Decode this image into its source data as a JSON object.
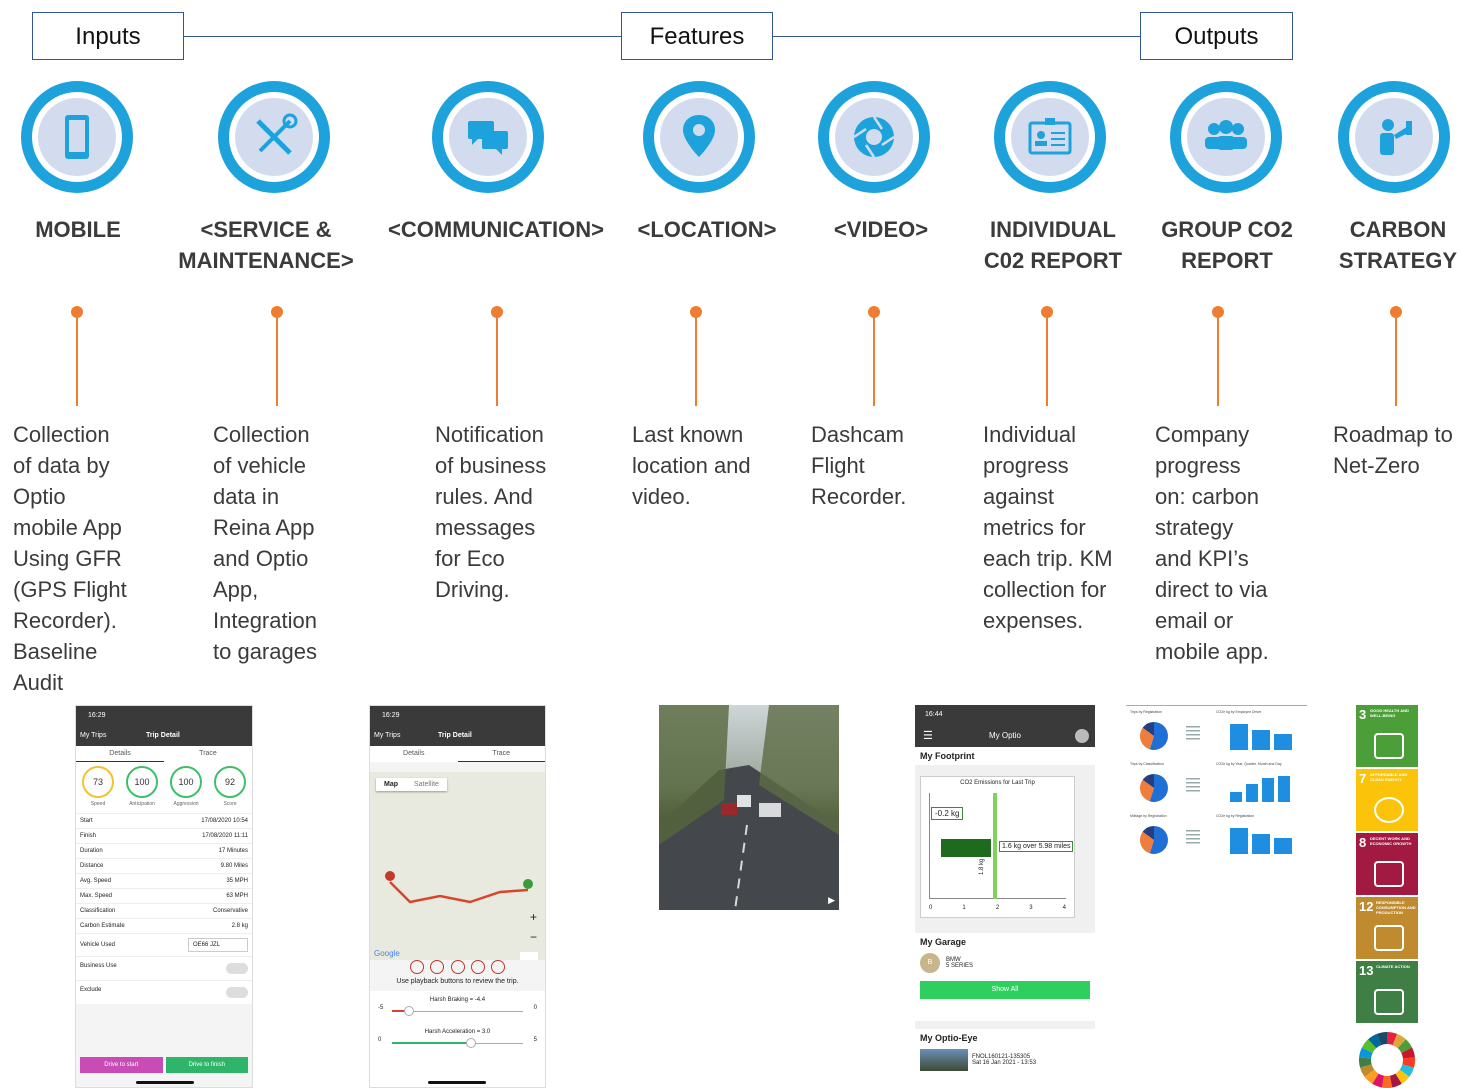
{
  "headers": {
    "inputs": "Inputs",
    "features": "Features",
    "outputs": "Outputs"
  },
  "columns": [
    {
      "icon": "mobile-phone-icon",
      "title": "MOBILE",
      "description": "Collection\nof data by\nOptio\nmobile App\nUsing GFR\n(GPS Flight\nRecorder).\nBaseline\nAudit"
    },
    {
      "icon": "tools-icon",
      "title": "<SERVICE &\nMAINTENANCE>",
      "description": "Collection\nof vehicle\ndata in\nReina App\nand Optio\nApp,\nIntegration\nto garages"
    },
    {
      "icon": "chat-bubbles-icon",
      "title": "<COMMUNICATION>",
      "description": "Notification\nof business\nrules. And\nmessages\nfor Eco\nDriving."
    },
    {
      "icon": "location-pin-icon",
      "title": "<LOCATION>",
      "description": "Last known\nlocation and\nvideo."
    },
    {
      "icon": "camera-shutter-icon",
      "title": "<VIDEO>",
      "description": "Dashcam\nFlight\nRecorder."
    },
    {
      "icon": "id-badge-icon",
      "title": "INDIVIDUAL\nC02  REPORT",
      "description": "Individual\nprogress\nagainst\nmetrics for\neach trip. KM\ncollection for\nexpenses."
    },
    {
      "icon": "group-icon",
      "title": "GROUP CO2\nREPORT",
      "description": "Company\nprogress\non:  carbon\nstrategy\nand KPI’s\ndirect to via\nemail or\nmobile app."
    },
    {
      "icon": "presenter-icon",
      "title": "CARBON\nSTRATEGY",
      "description": "Roadmap to\nNet-Zero"
    }
  ],
  "phone1": {
    "time": "16:29",
    "back": "My Trips",
    "title": "Trip Detail",
    "tabs": [
      "Details",
      "Trace"
    ],
    "gauges": [
      {
        "value": "73",
        "label": "Speed",
        "color": "#f2c230"
      },
      {
        "value": "100",
        "label": "Anticipation",
        "color": "#3fbf6a"
      },
      {
        "value": "100",
        "label": "Aggression",
        "color": "#3fbf6a"
      },
      {
        "value": "92",
        "label": "Score",
        "color": "#3fbf6a"
      }
    ],
    "rows": [
      {
        "k": "Start",
        "v": "17/08/2020 10:54"
      },
      {
        "k": "Finish",
        "v": "17/08/2020 11:11"
      },
      {
        "k": "Duration",
        "v": "17 Minutes"
      },
      {
        "k": "Distance",
        "v": "9.80 Miles"
      },
      {
        "k": "Avg. Speed",
        "v": "35 MPH"
      },
      {
        "k": "Max. Speed",
        "v": "63 MPH"
      },
      {
        "k": "Classification",
        "v": "Conservative"
      },
      {
        "k": "Carbon Estimate",
        "v": "2.8 kg"
      }
    ],
    "vehicle_label": "Vehicle Used",
    "vehicle_value": "OE66 JZL",
    "business_label": "Business Use",
    "exclude_label": "Exclude",
    "btn_start": "Drive to start",
    "btn_finish": "Drive to finish"
  },
  "phone2": {
    "time": "16:29",
    "back": "My Trips",
    "title": "Trip Detail",
    "tabs": [
      "Details",
      "Trace"
    ],
    "map_tabs": [
      "Map",
      "Satellite"
    ],
    "google": "Google",
    "hint": "Use playback buttons to review the trip.",
    "braking": "Harsh Braking = -4.4",
    "braking_min": "-5",
    "braking_max": "0",
    "accel": "Harsh Acceleration = 3.0",
    "accel_min": "0",
    "accel_max": "5"
  },
  "phone3": {
    "time": "16:44",
    "title": "My Optio",
    "footprint": "My Footprint",
    "chart_title": "CO2 Emissions for Last Trip",
    "delta": "-0.2 kg",
    "bar_label": "1.6 kg over 5.98 miles",
    "vert_label": "1.8 kg",
    "ticks": [
      "0",
      "1",
      "2",
      "3",
      "4"
    ],
    "garage": "My Garage",
    "avatar": "B",
    "car_make": "BMW",
    "car_model": "5 SERIES",
    "show_all": "Show All",
    "eye": "My Optio-Eye",
    "clip_id": "FNOL160121-135305",
    "clip_date": "Sat 16 Jan 2021 - 13:53"
  },
  "report": {
    "charts": [
      {
        "title": "Trips by Registration"
      },
      {
        "title": "CO2e kg by Employee Driver"
      },
      {
        "title": "Trips by Classification"
      },
      {
        "title": "CO2e kg by Year, Quarter, Month and Day"
      },
      {
        "title": "Mileage by Registration"
      },
      {
        "title": "CO2e kg by Registration"
      }
    ]
  },
  "sdgs": [
    {
      "num": "3",
      "text": "GOOD HEALTH AND WELL-BEING",
      "color": "#4c9f38"
    },
    {
      "num": "7",
      "text": "AFFORDABLE AND CLEAN ENERGY",
      "color": "#fcc30b"
    },
    {
      "num": "8",
      "text": "DECENT WORK AND ECONOMIC GROWTH",
      "color": "#a21942"
    },
    {
      "num": "12",
      "text": "RESPONSIBLE CONSUMPTION AND PRODUCTION",
      "color": "#bf8b2e"
    },
    {
      "num": "13",
      "text": "CLIMATE ACTION",
      "color": "#3f7e44"
    }
  ]
}
